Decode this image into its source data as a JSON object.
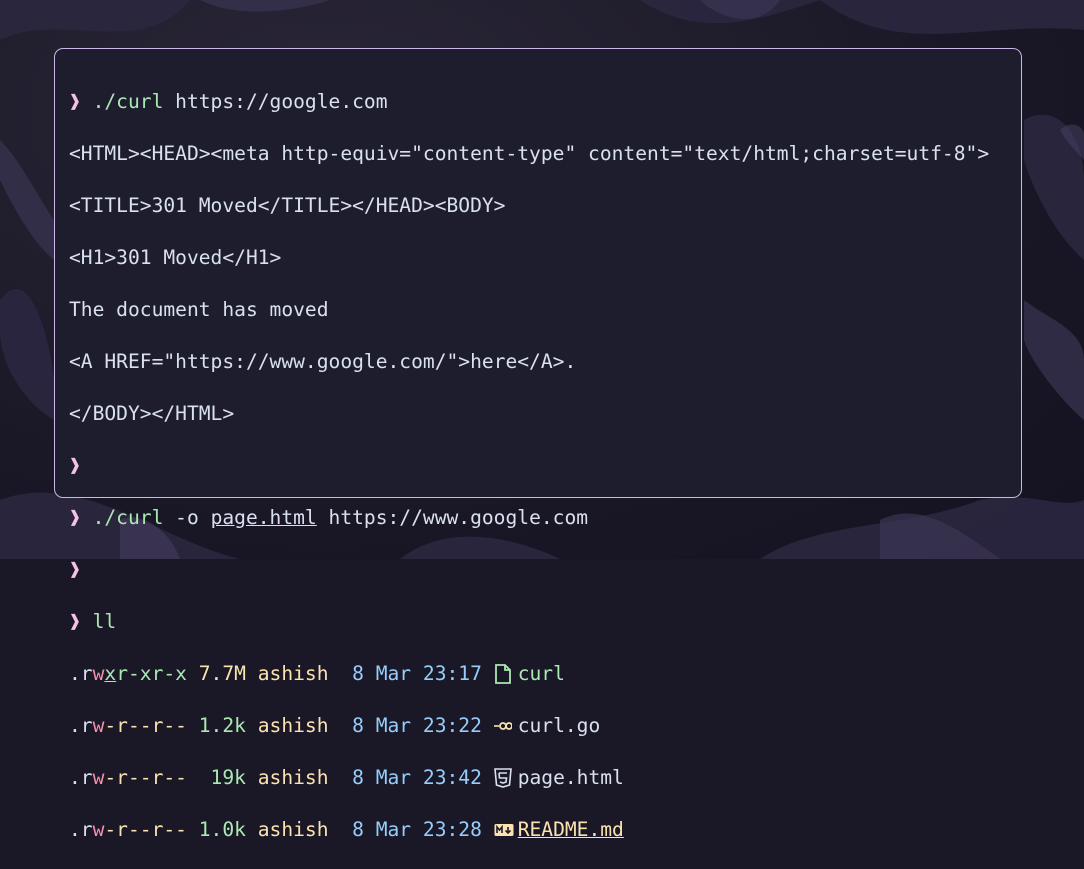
{
  "terminal": {
    "prompt_symbol": "❱",
    "lines": {
      "l1": {
        "cmd": "./curl",
        "arg": "https://google.com"
      },
      "l2": "<HTML><HEAD><meta http-equiv=\"content-type\" content=\"text/html;charset=utf-8\">",
      "l3": "<TITLE>301 Moved</TITLE></HEAD><BODY>",
      "l4": "<H1>301 Moved</H1>",
      "l5": "The document has moved",
      "l6": "<A HREF=\"https://www.google.com/\">here</A>.",
      "l7": "</BODY></HTML>",
      "l9": {
        "cmd": "./curl",
        "flag": "-o",
        "file": "page.html",
        "url": "https://www.google.com"
      },
      "l11": {
        "cmd": "ll"
      }
    },
    "listing": [
      {
        "perm_prefix": ".r",
        "perm_w": "w",
        "perm_x": "x",
        "perm_rest": "r-xr-x",
        "size_num": "7.7",
        "size_unit": "M",
        "user": "ashish",
        "day": "8",
        "month": "Mar",
        "time": "23:17",
        "icon": "file-icon",
        "name": "curl"
      },
      {
        "perm_prefix": ".r",
        "perm_w": "w",
        "perm_x": "",
        "perm_rest": "-r--r--",
        "size_num": "1.2",
        "size_unit": "k",
        "user": "ashish",
        "day": "8",
        "month": "Mar",
        "time": "23:22",
        "icon": "go-icon",
        "name": "curl.go"
      },
      {
        "perm_prefix": ".r",
        "perm_w": "w",
        "perm_x": "",
        "perm_rest": "-r--r--",
        "size_num": " 19",
        "size_unit": "k",
        "user": "ashish",
        "day": "8",
        "month": "Mar",
        "time": "23:42",
        "icon": "html5-icon",
        "name": "page.html"
      },
      {
        "perm_prefix": ".r",
        "perm_w": "w",
        "perm_x": "",
        "perm_rest": "-r--r--",
        "size_num": "1.0",
        "size_unit": "k",
        "user": "ashish",
        "day": "8",
        "month": "Mar",
        "time": "23:28",
        "icon": "markdown-icon",
        "name": "README.md"
      }
    ]
  },
  "colors": {
    "border": "#c9b8e8",
    "background": "#1e1d2d",
    "prompt": "#f5c2e7",
    "command": "#abe9b3",
    "user": "#fae3b0",
    "date": "#96cdfb"
  }
}
